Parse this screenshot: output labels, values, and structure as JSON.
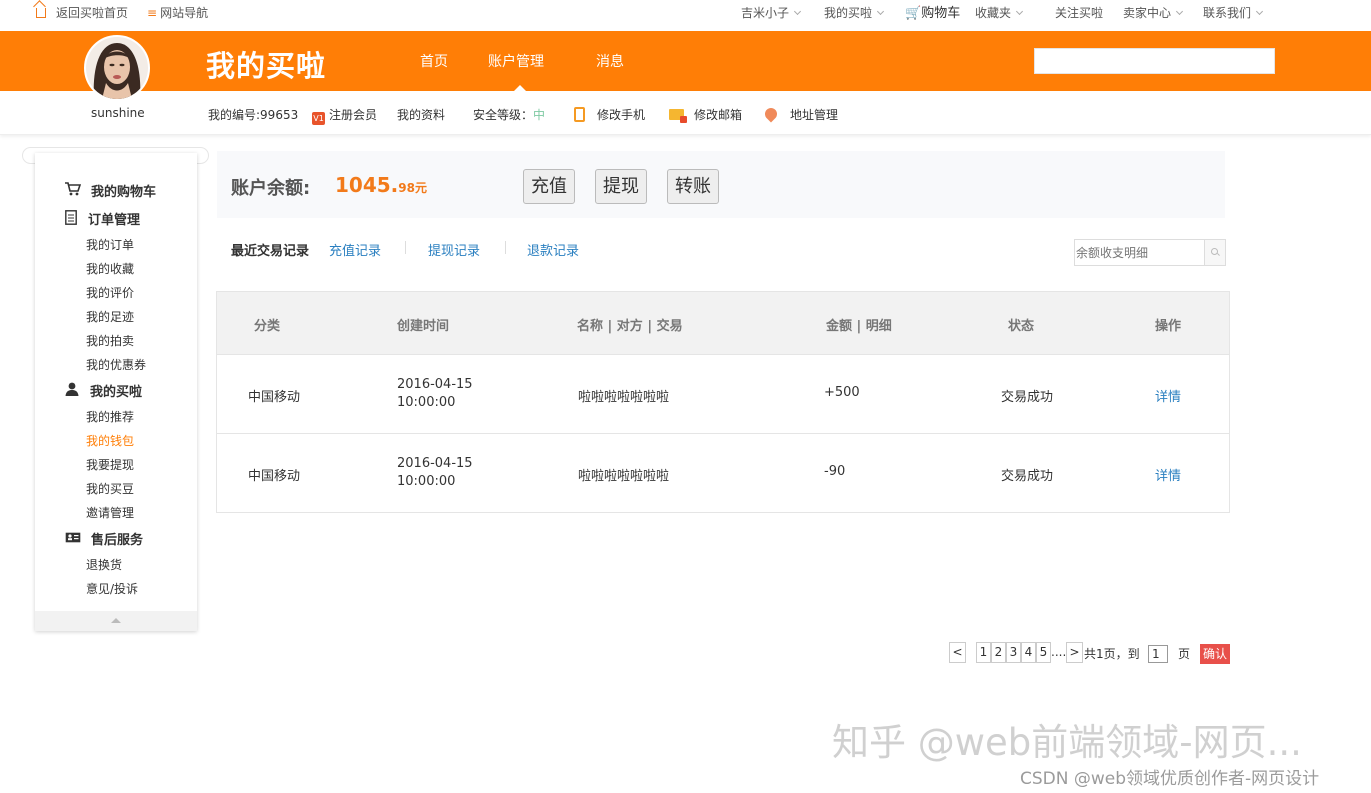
{
  "topbar": {
    "home_link": "返回买啦首页",
    "site_nav": "网站导航",
    "user_name": "吉米小子",
    "my_account": "我的买啦",
    "cart": "购物车",
    "favorites": "收藏夹",
    "follow": "关注买啦",
    "seller_center": "卖家中心",
    "contact": "联系我们"
  },
  "header": {
    "brand": "我的买啦",
    "nav": [
      "首页",
      "账户管理",
      "消息"
    ],
    "active_nav": "账户管理",
    "search_placeholder": ""
  },
  "profile": {
    "username": "sunshine",
    "member_id": "我的编号:99653",
    "vip_badge": "V1",
    "register_member": "注册会员",
    "my_info": "我的资料",
    "security_label": "安全等级：",
    "security_level": "中",
    "change_phone": "修改手机",
    "change_email": "修改邮箱",
    "address_mgmt": "地址管理"
  },
  "sidebar": {
    "groups": [
      {
        "title": "我的购物车",
        "items": []
      },
      {
        "title": "订单管理",
        "items": [
          "我的订单",
          "我的收藏",
          "我的评价",
          "我的足迹",
          "我的拍卖",
          "我的优惠券"
        ]
      },
      {
        "title": "我的买啦",
        "items": [
          "我的推荐",
          "我的钱包",
          "我要提现",
          "我的买豆",
          "邀请管理"
        ]
      },
      {
        "title": "售后服务",
        "items": [
          "退换货",
          "意见/投诉"
        ]
      }
    ],
    "active_item": "我的钱包"
  },
  "balance": {
    "label": "账户余额:",
    "amount_int": "1045.",
    "amount_dec": "98元",
    "buttons": [
      "充值",
      "提现",
      "转账"
    ]
  },
  "records": {
    "tabs": [
      "最近交易记录",
      "充值记录",
      "提现记录",
      "退款记录"
    ],
    "search_placeholder": "余额收支明细"
  },
  "table": {
    "headers": [
      "分类",
      "创建时间",
      "名称 | 对方 | 交易",
      "金额 | 明细",
      "状态",
      "操作"
    ],
    "rows": [
      {
        "category": "中国移动",
        "date": "2016-04-15",
        "time": "10:00:00",
        "name": "啦啦啦啦啦啦啦",
        "amount": "+500",
        "status": "交易成功",
        "action": "详情"
      },
      {
        "category": "中国移动",
        "date": "2016-04-15",
        "time": "10:00:00",
        "name": "啦啦啦啦啦啦啦",
        "amount": "-90",
        "status": "交易成功",
        "action": "详情"
      }
    ]
  },
  "pagination": {
    "prev": "<",
    "pages": [
      "1",
      "2",
      "3",
      "4",
      "5"
    ],
    "ellipsis": ".....",
    "next": ">",
    "total": "共1页，到",
    "current": "1",
    "page_unit": "页",
    "confirm": "确认"
  },
  "watermark": {
    "main": "知乎 @web前端领域-网页...",
    "sub": "CSDN @web领域优质创作者-网页设计"
  },
  "colors": {
    "brand_orange": "#ff7e06",
    "link_blue": "#2a7fc0",
    "amount_orange": "#f27a1a",
    "confirm_red": "#e8504a"
  }
}
